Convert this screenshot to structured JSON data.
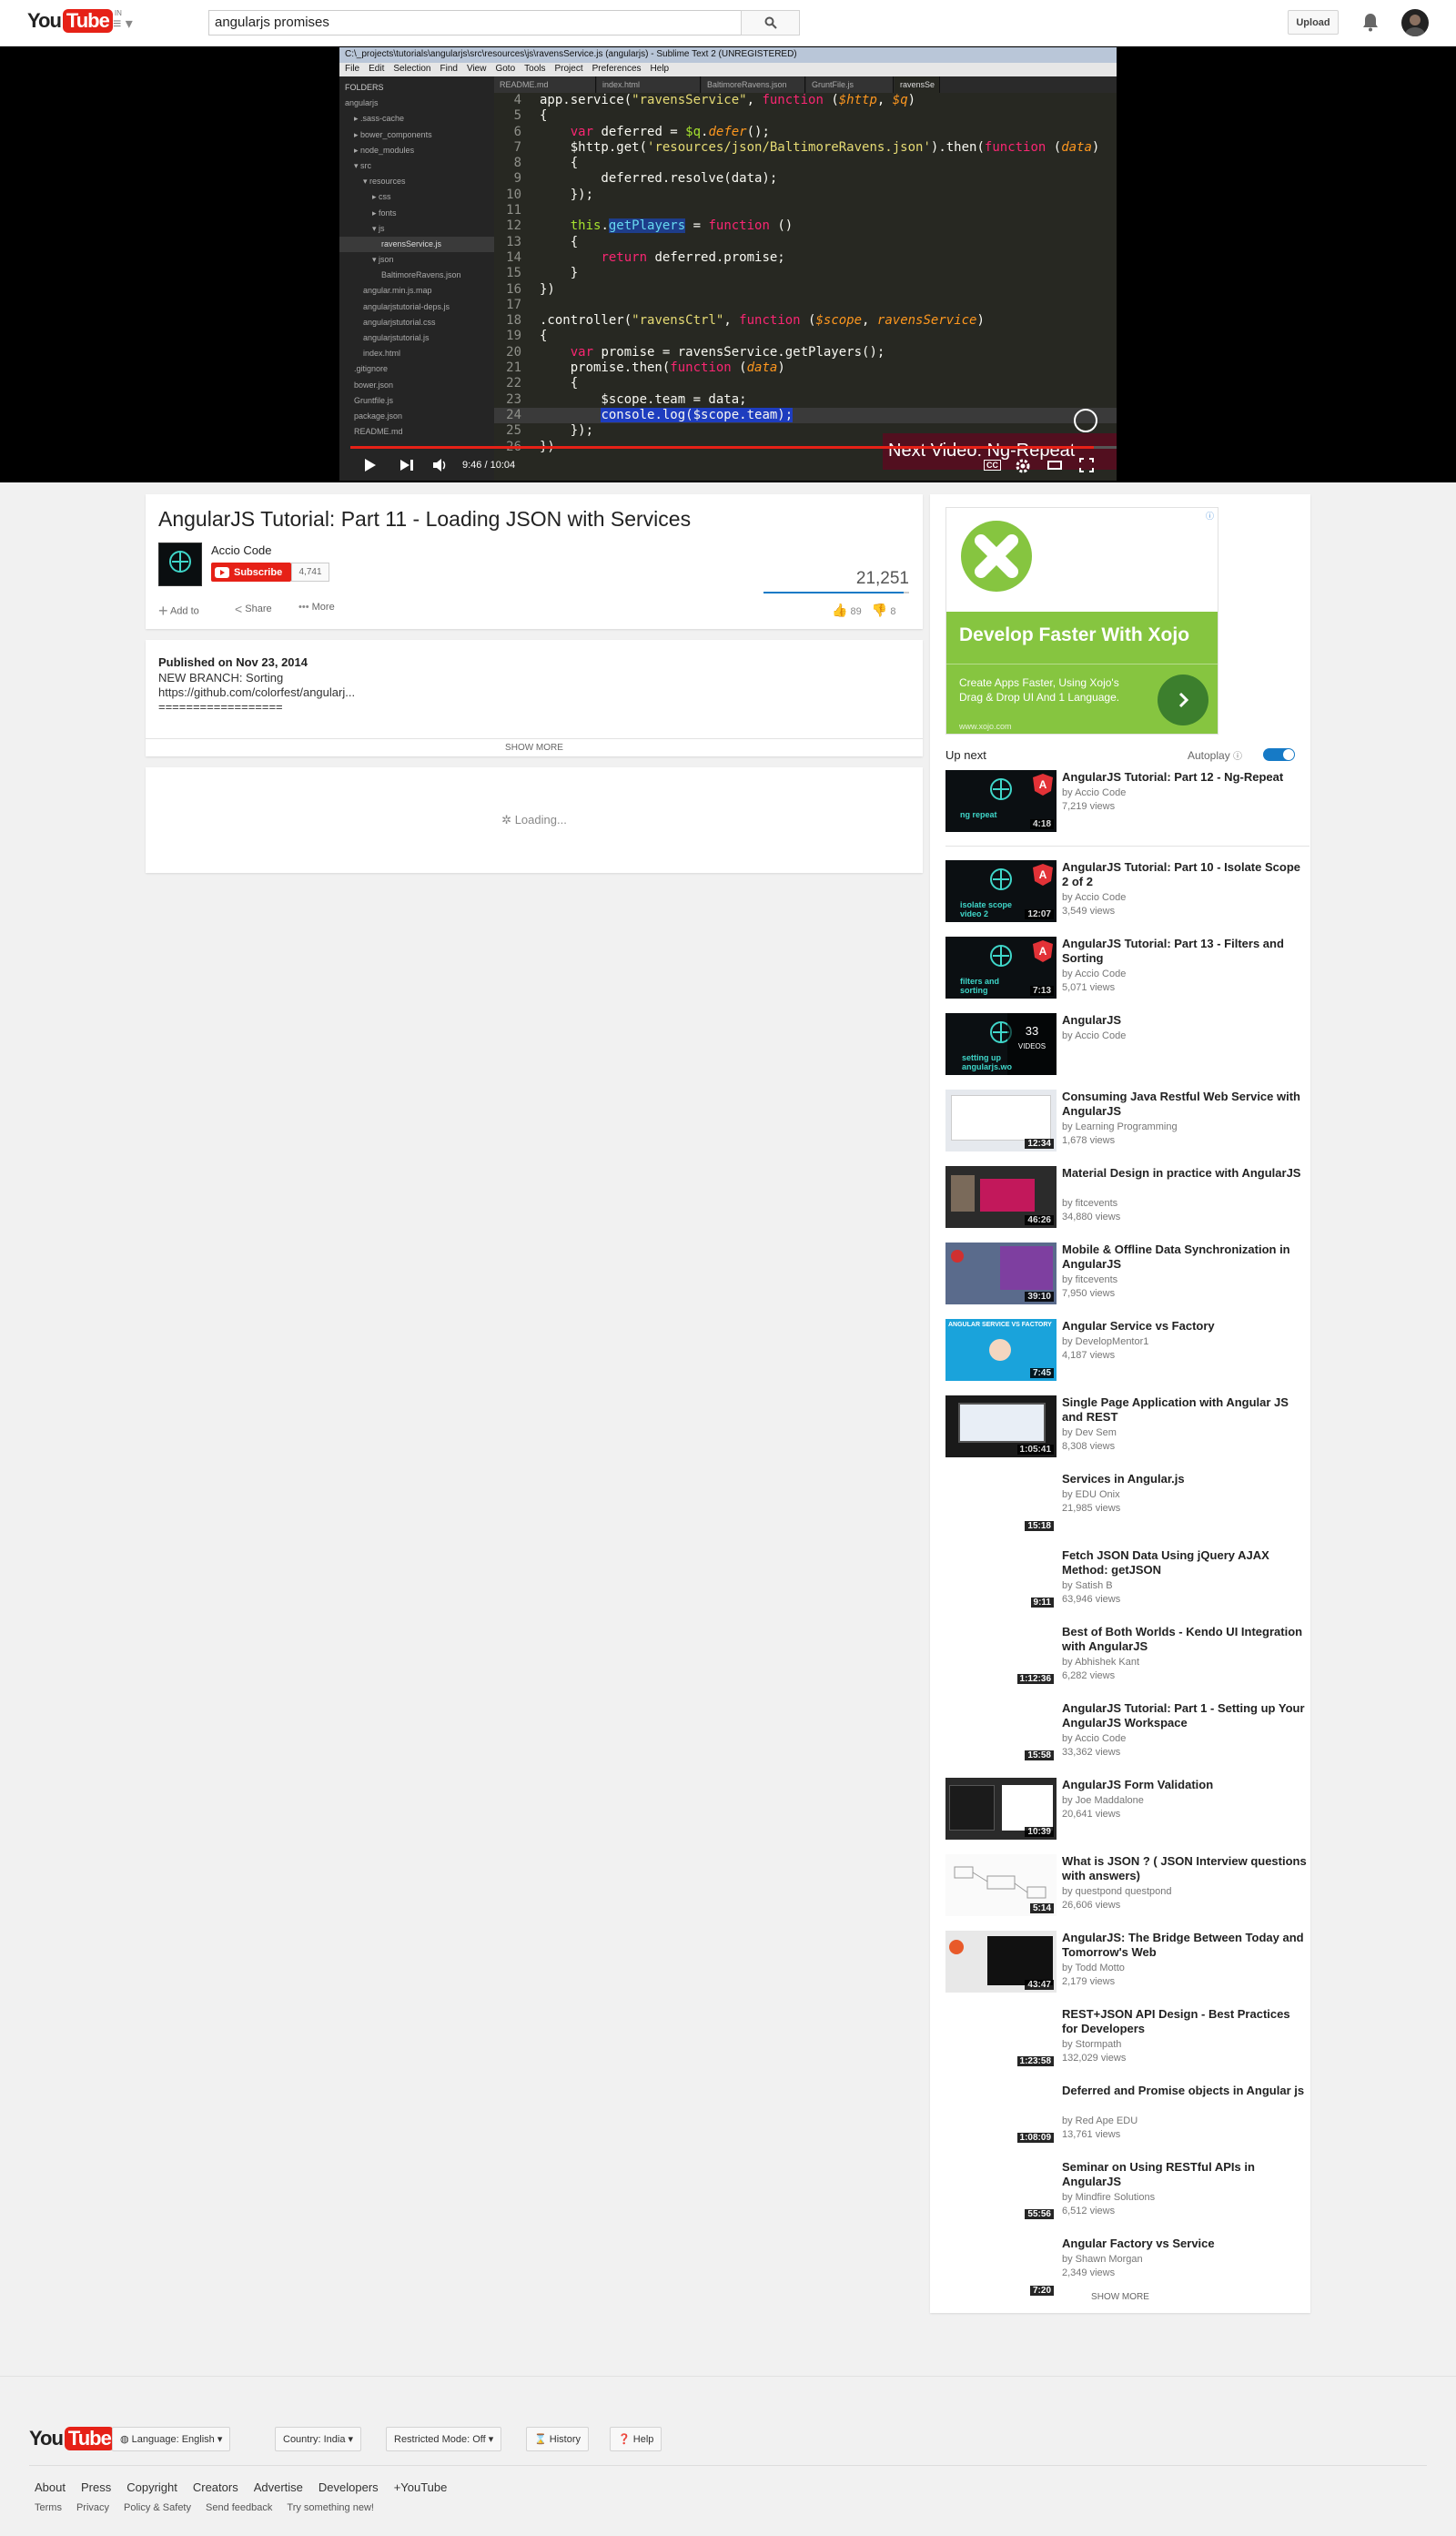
{
  "header": {
    "logo_you": "You",
    "logo_tube": "Tube",
    "logo_country": "IN",
    "search_value": "angularjs promises",
    "upload_label": "Upload"
  },
  "player": {
    "editor_title": "C:\\_projects\\tutorials\\angularjs\\src\\resources\\js\\ravensService.js (angularjs) - Sublime Text 2 (UNREGISTERED)",
    "menu": [
      "File",
      "Edit",
      "Selection",
      "Find",
      "View",
      "Goto",
      "Tools",
      "Project",
      "Preferences",
      "Help"
    ],
    "folders_label": "FOLDERS",
    "tree": [
      "angularjs",
      "▸ .sass-cache",
      "▸ bower_components",
      "▸ node_modules",
      "▾ src",
      "▾ resources",
      "▸ css",
      "▸ fonts",
      "▾ js",
      "ravensService.js",
      "▾ json",
      "BaltimoreRavens.json",
      "angular.min.js.map",
      "angularjstutorial-deps.js",
      "angularjstutorial.css",
      "angularjstutorial.js",
      "index.html",
      ".gitignore",
      "bower.json",
      "Gruntfile.js",
      "package.json",
      "README.md"
    ],
    "tabs": [
      "README.md",
      "index.html",
      "BaltimoreRavens.json",
      "GruntFile.js",
      "ravensSe"
    ],
    "current_time": "9:46 / 10:04",
    "progress": 0.97,
    "next_video": "Next Video: Ng-Repeat",
    "cc_label": "CC"
  },
  "watch": {
    "title": "AngularJS Tutorial: Part 11 - Loading JSON with Services",
    "channel": "Accio Code",
    "subscribe_label": "Subscribe",
    "subscriber_count": "4,741",
    "views": "21,251",
    "add_to_label": "Add to",
    "share_label": "Share",
    "more_label": "More",
    "likes": "89",
    "dislikes": "8",
    "like_ratio": 0.96
  },
  "description": {
    "published": "Published on Nov 23, 2014",
    "line1": "NEW BRANCH: Sorting",
    "line2": "https://github.com/colorfest/angularj...",
    "line3": "==================",
    "show_more": "SHOW MORE"
  },
  "comments": {
    "loading": "Loading..."
  },
  "ad": {
    "headline": "Develop Faster With Xojo",
    "body": "Create Apps Faster, Using Xojo's Drag & Drop UI And 1 Language.",
    "url": "www.xojo.com",
    "brand_color": "#86c540"
  },
  "sidebar": {
    "up_next": "Up next",
    "autoplay": "Autoplay",
    "show_more": "SHOW MORE",
    "videos": [
      {
        "title": "AngularJS Tutorial: Part 12 - Ng-Repeat",
        "by": "by Accio Code",
        "views": "7,219 views",
        "duration": "4:18",
        "thumb": "ng repeat",
        "style": "accio"
      },
      {
        "title": "AngularJS Tutorial: Part 10 - Isolate Scope 2 of 2",
        "by": "by Accio Code",
        "views": "3,549 views",
        "duration": "12:07",
        "thumb": "isolate scope video 2",
        "style": "accio"
      },
      {
        "title": "AngularJS Tutorial: Part 13 - Filters and Sorting",
        "by": "by Accio Code",
        "views": "5,071 views",
        "duration": "7:13",
        "thumb": "filters and sorting",
        "style": "accio"
      },
      {
        "title": "AngularJS",
        "by": "by Accio Code",
        "views": "",
        "duration": "",
        "thumb": "setting up angularjs.wo",
        "style": "playlist",
        "count": "33",
        "count_label": "VIDEOS"
      },
      {
        "title": "Consuming Java Restful Web Service with AngularJS",
        "by": "by Learning Programming",
        "views": "1,678 views",
        "duration": "12:34",
        "thumb": "",
        "style": "light"
      },
      {
        "title": "Material Design in practice with AngularJS",
        "by": "by fitcevents",
        "views": "34,880 views",
        "duration": "46:26",
        "thumb": "",
        "style": "dark"
      },
      {
        "title": "Mobile & Offline Data Synchronization in AngularJS",
        "by": "by fitcevents",
        "views": "7,950 views",
        "duration": "39:10",
        "thumb": "",
        "style": "purple"
      },
      {
        "title": "Angular Service vs Factory",
        "by": "by DevelopMentor1",
        "views": "4,187 views",
        "duration": "7:45",
        "thumb": "ANGULAR SERVICE VS FACTORY",
        "style": "blue"
      },
      {
        "title": "Single Page Application with Angular JS and REST",
        "by": "by Dev Sem",
        "views": "8,308 views",
        "duration": "1:05:41",
        "thumb": "",
        "style": "darkwin"
      },
      {
        "title": "Services in Angular.js",
        "by": "by EDU Onix",
        "views": "21,985 views",
        "duration": "15:18",
        "thumb": "",
        "style": "white"
      },
      {
        "title": "Fetch JSON Data Using jQuery AJAX Method: getJSON",
        "by": "by Satish B",
        "views": "63,946 views",
        "duration": "9:11",
        "thumb": "",
        "style": "white"
      },
      {
        "title": "Best of Both Worlds - Kendo UI Integration with AngularJS",
        "by": "by Abhishek Kant",
        "views": "6,282 views",
        "duration": "1:12:36",
        "thumb": "",
        "style": "white"
      },
      {
        "title": "AngularJS Tutorial: Part 1 - Setting up Your AngularJS Workspace",
        "by": "by Accio Code",
        "views": "33,362 views",
        "duration": "15:58",
        "thumb": "",
        "style": "white"
      },
      {
        "title": "AngularJS Form Validation",
        "by": "by Joe Maddalone",
        "views": "20,641 views",
        "duration": "10:39",
        "thumb": "",
        "style": "code"
      },
      {
        "title": "What is JSON ? ( JSON Interview questions with answers)",
        "by": "by questpond questpond",
        "views": "26,606 views",
        "duration": "5:14",
        "thumb": "",
        "style": "diagram"
      },
      {
        "title": "AngularJS: The Bridge Between Today and Tomorrow's Web",
        "by": "by Todd Motto",
        "views": "2,179 views",
        "duration": "43:47",
        "thumb": "",
        "style": "slides"
      },
      {
        "title": "REST+JSON API Design - Best Practices for Developers",
        "by": "by Stormpath",
        "views": "132,029 views",
        "duration": "1:23:58",
        "thumb": "",
        "style": "white"
      },
      {
        "title": "Deferred and Promise objects in Angular js",
        "by": "by Red Ape EDU",
        "views": "13,761 views",
        "duration": "1:08:09",
        "thumb": "",
        "style": "white"
      },
      {
        "title": "Seminar on Using RESTful APIs in AngularJS",
        "by": "by Mindfire Solutions",
        "views": "6,512 views",
        "duration": "55:56",
        "thumb": "",
        "style": "white"
      },
      {
        "title": "Angular Factory vs Service",
        "by": "by Shawn Morgan",
        "views": "2,349 views",
        "duration": "7:20",
        "thumb": "",
        "style": "white"
      }
    ]
  },
  "footer": {
    "language": "Language: English",
    "country": "Country: India",
    "restricted": "Restricted Mode: Off",
    "history": "History",
    "help": "Help",
    "links": [
      "About",
      "Press",
      "Copyright",
      "Creators",
      "Advertise",
      "Developers",
      "+YouTube"
    ],
    "links2": [
      "Terms",
      "Privacy",
      "Policy & Safety",
      "Send feedback",
      "Try something new!"
    ]
  }
}
